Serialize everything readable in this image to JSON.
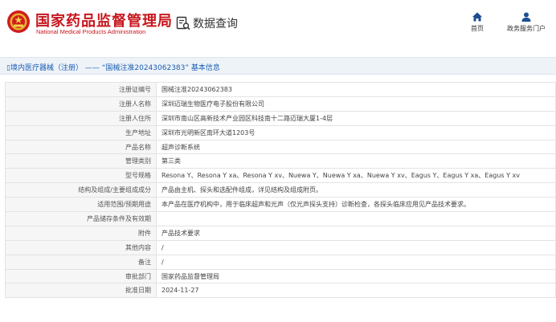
{
  "header": {
    "org_name_cn": "国家药品监督管理局",
    "org_name_en": "National Medical Products Administration",
    "query_label": "数据查询",
    "nav": [
      {
        "label": "首页",
        "icon": "home-icon"
      },
      {
        "label": "政务服务门户",
        "icon": "user-icon"
      }
    ]
  },
  "breadcrumb": {
    "category": "境内医疗器械（注册）",
    "separator": "——",
    "current": "“国械注准20243062383” 基本信息"
  },
  "colors": {
    "brand_red": "#c8161d",
    "link_blue": "#1a5db4",
    "bar_bg": "#eef3f8"
  },
  "details": [
    {
      "key": "注册证编号",
      "value": "国械注准20243062383"
    },
    {
      "key": "注册人名称",
      "value": "深圳迈瑞生物医疗电子股份有限公司"
    },
    {
      "key": "注册人住所",
      "value": "深圳市南山区高新技术产业园区科技南十二路迈瑞大厦1-4层"
    },
    {
      "key": "生产地址",
      "value": "深圳市光明新区南环大道1203号"
    },
    {
      "key": "产品名称",
      "value": "超声诊断系统"
    },
    {
      "key": "管理类别",
      "value": "第三类"
    },
    {
      "key": "型号规格",
      "value": "Resona Y、Resona Y xa、Resona Y xv、Nuewa Y、Nuewa Y xa、Nuewa Y xv、Eagus Y、Eagus Y xa、Eagus Y xv"
    },
    {
      "key": "结构及组成/主要组成成分",
      "value": "产品由主机、探头和选配件组成，详见结构及组成附页。"
    },
    {
      "key": "适用范围/预期用途",
      "value": "本产品在医疗机构中，用于临床超声和光声（仅光声探头支持）诊断检查，各探头临床应用见产品技术要求。"
    },
    {
      "key": "产品储存条件及有效期",
      "value": ""
    },
    {
      "key": "附件",
      "value": "产品技术要求"
    },
    {
      "key": "其他内容",
      "value": "/"
    },
    {
      "key": "备注",
      "value": "/"
    },
    {
      "key": "审批部门",
      "value": "国家药品监督管理局"
    },
    {
      "key": "批准日期",
      "value": "2024-11-27"
    }
  ]
}
